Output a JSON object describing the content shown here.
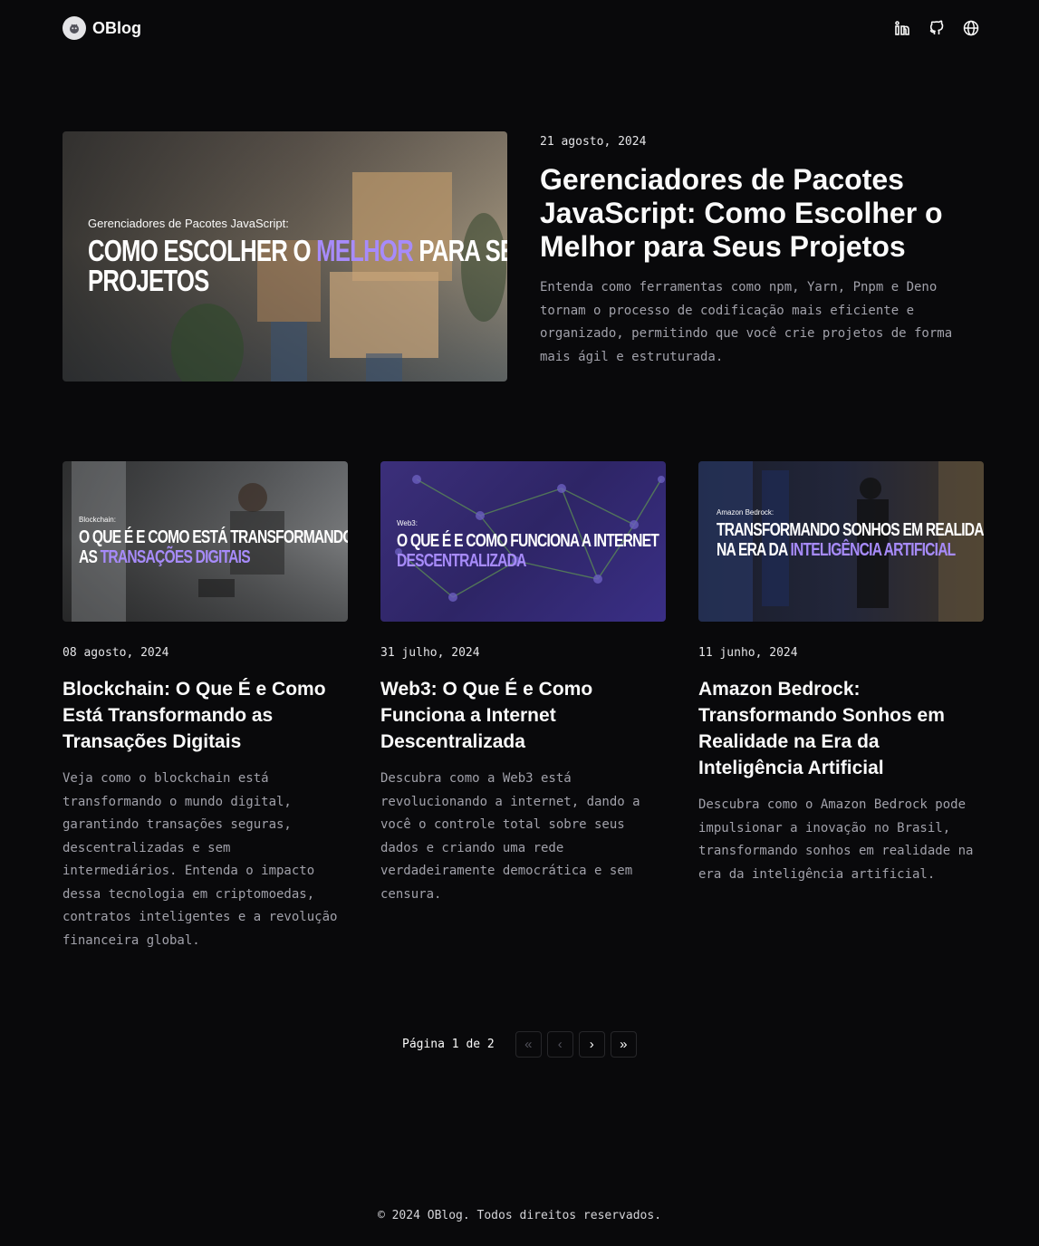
{
  "header": {
    "brand": "OBlog",
    "icons": [
      "linkedin-icon",
      "github-icon",
      "globe-icon"
    ]
  },
  "featured": {
    "date": "21 agosto, 2024",
    "title": "Gerenciadores de Pacotes JavaScript: Como Escolher o Melhor para Seus Projetos",
    "excerpt": "Entenda como ferramentas como npm, Yarn, Pnpm e Deno tornam o processo de codificação mais eficiente e organizado, permitindo que você crie projetos de forma mais ágil e estruturada.",
    "image": {
      "kicker": "Gerenciadores de Pacotes JavaScript:",
      "line1a": "COMO ESCOLHER O ",
      "line1accent": "MELHOR",
      "line1b": " PARA SEUS",
      "line2": "PROJETOS"
    }
  },
  "posts": [
    {
      "date": "08 agosto, 2024",
      "title": "Blockchain: O Que É e Como Está Transformando as Transações Digitais",
      "excerpt": "Veja como o blockchain está transformando o mundo digital, garantindo transações seguras, descentralizadas e sem intermediários. Entenda o impacto dessa tecnologia em criptomoedas, contratos inteligentes e a revolução financeira global.",
      "image": {
        "kicker": "Blockchain:",
        "line1": "O QUE É E COMO ESTÁ TRANSFORMANDO",
        "line2a": "AS ",
        "line2accent": "TRANSAÇÕES DIGITAIS"
      }
    },
    {
      "date": "31 julho, 2024",
      "title": "Web3: O Que É e Como Funciona a Internet Descentralizada",
      "excerpt": "Descubra como a Web3 está revolucionando a internet, dando a você o controle total sobre seus dados e criando uma rede verdadeiramente democrática e sem censura.",
      "image": {
        "kicker": "Web3:",
        "line1": "O QUE É E COMO FUNCIONA A INTERNET",
        "line2a": "",
        "line2accent": "DESCENTRALIZADA"
      }
    },
    {
      "date": "11 junho, 2024",
      "title": "Amazon Bedrock: Transformando Sonhos em Realidade na Era da Inteligência Artificial",
      "excerpt": "Descubra como o Amazon Bedrock pode impulsionar a inovação no Brasil, transformando sonhos em realidade na era da inteligência artificial.",
      "image": {
        "kicker": "Amazon Bedrock:",
        "line1": "TRANSFORMANDO SONHOS EM REALIDADE",
        "line2a": "NA ERA DA ",
        "line2accent": "INTELIGÊNCIA ARTIFICIAL"
      }
    }
  ],
  "pagination": {
    "label": "Página 1 de 2",
    "first": "«",
    "prev": "‹",
    "next": "›",
    "last": "»"
  },
  "footer": {
    "text": "© 2024 OBlog. Todos direitos reservados."
  }
}
